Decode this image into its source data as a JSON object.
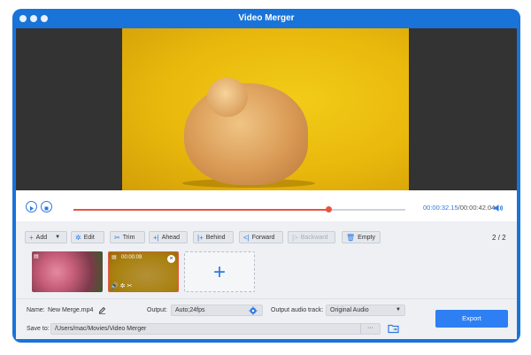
{
  "window": {
    "title": "Video Merger"
  },
  "player": {
    "current_time": "00:00:32.15",
    "separator": "/",
    "total_time": "00:00:42.04",
    "progress": 0.77
  },
  "toolbar": {
    "add": "Add",
    "edit": "Edit",
    "trim": "Trim",
    "ahead": "Ahead",
    "behind": "Behind",
    "forward": "Forward",
    "backward": "Backward",
    "empty": "Empty",
    "page_current": "2",
    "page_sep": "/",
    "page_total": "2"
  },
  "clips": [
    {
      "thumb": "pink-flowers"
    },
    {
      "thumb": "hamster",
      "duration": "00:00:09",
      "selected": true
    }
  ],
  "bottom": {
    "name_label": "Name:",
    "name_value": "New Merge.mp4",
    "output_label": "Output:",
    "output_value": "Auto;24fps",
    "audio_label": "Output audio track:",
    "audio_value": "Original Audio",
    "save_label": "Save to:",
    "save_path": "/Users/mac/Movies/Video Merger",
    "more": "···",
    "export": "Export"
  },
  "colors": {
    "accent": "#2d79e0",
    "progress": "#e8533f",
    "window_frame": "#1a73d9"
  }
}
